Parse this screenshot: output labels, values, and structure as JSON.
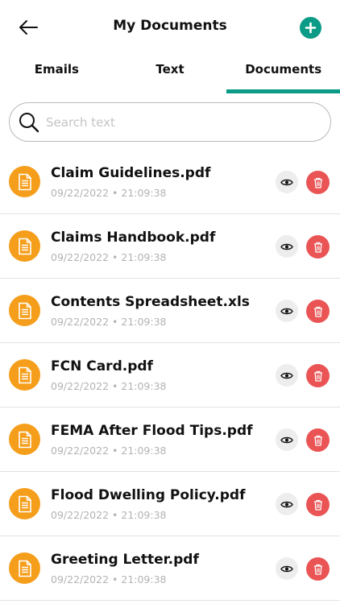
{
  "header": {
    "title": "My Documents",
    "back_icon": "arrow-left-icon",
    "add_icon": "plus-circle-icon"
  },
  "tabs": [
    {
      "label": "Emails",
      "active": false
    },
    {
      "label": "Text",
      "active": false
    },
    {
      "label": "Documents",
      "active": true
    }
  ],
  "search": {
    "placeholder": "Search text",
    "value": ""
  },
  "documents": [
    {
      "name": "Claim Guidelines.pdf",
      "date": "09/22/2022 • 21:09:38"
    },
    {
      "name": "Claims Handbook.pdf",
      "date": "09/22/2022 • 21:09:38"
    },
    {
      "name": "Contents Spreadsheet.xls",
      "date": "09/22/2022 • 21:09:38"
    },
    {
      "name": "FCN Card.pdf",
      "date": "09/22/2022 • 21:09:38"
    },
    {
      "name": "FEMA After Flood Tips.pdf",
      "date": "09/22/2022 • 21:09:38"
    },
    {
      "name": "Flood Dwelling Policy.pdf",
      "date": "09/22/2022 • 21:09:38"
    },
    {
      "name": "Greeting Letter.pdf",
      "date": "09/22/2022 • 21:09:38"
    }
  ],
  "colors": {
    "accent": "#0b9b86",
    "file_icon": "#f59e1b",
    "delete": "#ea5455",
    "view_bg": "#ededed"
  }
}
